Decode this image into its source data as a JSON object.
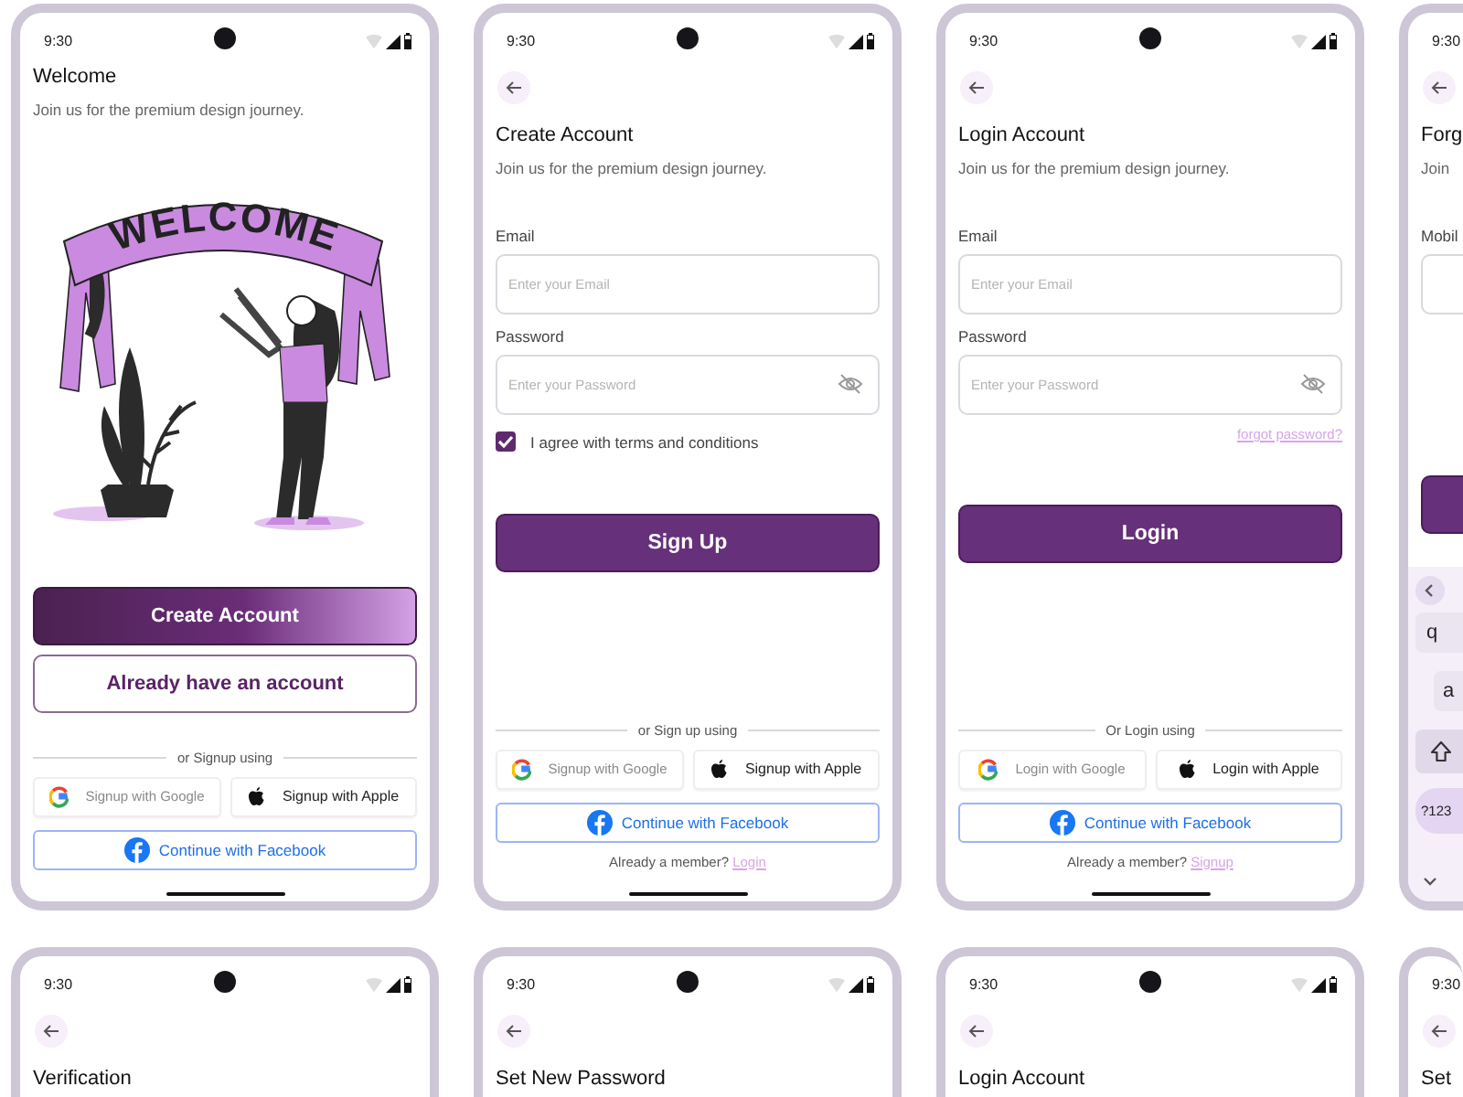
{
  "phones": [
    {
      "time": "9:30",
      "back_button": false,
      "home_indicator": true,
      "sections": [
        {
          "kind": "title",
          "text": "Welcome"
        },
        {
          "kind": "subtitle",
          "text": "Join us for the premium design journey."
        },
        {
          "kind": "illustration",
          "banner_text": "WELCOME"
        },
        {
          "kind": "gradient_button",
          "label": "Create Account"
        },
        {
          "kind": "outline_button",
          "label": "Already have an account"
        },
        {
          "kind": "divider",
          "text": "or Signup using"
        },
        {
          "kind": "social_row",
          "google": "Signup with Google",
          "apple": "Signup with Apple"
        },
        {
          "kind": "facebook",
          "label": "Continue with Facebook"
        }
      ]
    },
    {
      "time": "9:30",
      "back_button": true,
      "home_indicator": true,
      "sections": [
        {
          "kind": "title",
          "text": "Create Account"
        },
        {
          "kind": "subtitle",
          "text": "Join us for the premium design journey."
        },
        {
          "kind": "field",
          "secure": false,
          "label": "Email",
          "placeholder": "Enter your Email"
        },
        {
          "kind": "field",
          "secure": true,
          "label": "Password",
          "placeholder": "Enter your Password"
        },
        {
          "kind": "checkbox",
          "checked": true,
          "label": "I agree with terms and conditions"
        },
        {
          "kind": "solid_button",
          "label": "Sign Up"
        },
        {
          "kind": "divider",
          "text": "or Sign up using"
        },
        {
          "kind": "social_row",
          "google": "Signup with Google",
          "apple": "Signup with Apple"
        },
        {
          "kind": "facebook",
          "label": "Continue with Facebook"
        },
        {
          "kind": "footer",
          "text": "Already a member?",
          "link": "Login"
        }
      ]
    },
    {
      "time": "9:30",
      "back_button": true,
      "home_indicator": true,
      "sections": [
        {
          "kind": "title",
          "text": "Login Account"
        },
        {
          "kind": "subtitle",
          "text": "Join us for the premium design journey."
        },
        {
          "kind": "field",
          "secure": false,
          "label": "Email",
          "placeholder": "Enter your Email"
        },
        {
          "kind": "field",
          "secure": true,
          "label": "Password",
          "placeholder": "Enter your Password"
        },
        {
          "kind": "link",
          "text": "forgot password?"
        },
        {
          "kind": "solid_button",
          "label": "Login"
        },
        {
          "kind": "divider",
          "text": "Or Login using"
        },
        {
          "kind": "social_row",
          "google": "Login with Google",
          "apple": "Login with Apple"
        },
        {
          "kind": "facebook",
          "label": "Continue with Facebook"
        },
        {
          "kind": "footer",
          "text": "Already a member?",
          "link": "Signup"
        }
      ]
    },
    {
      "time": "9:30",
      "back_button": true,
      "home_indicator": false,
      "sections": [
        {
          "kind": "title",
          "text": "Forg"
        },
        {
          "kind": "subtitle",
          "text": "Join"
        },
        {
          "kind": "field",
          "secure": false,
          "label": "Mobil"
        },
        {
          "kind": "solid_button"
        },
        {
          "kind": "keyboard",
          "keys": [
            {
              "kind": "letter",
              "label": "q"
            },
            {
              "kind": "letter",
              "label": "a"
            },
            {
              "kind": "shift"
            },
            {
              "kind": "mode",
              "label": "?123"
            }
          ]
        }
      ]
    },
    {
      "time": "9:30",
      "back_button": true,
      "home_indicator": false,
      "sections": [
        {
          "kind": "title",
          "text": "Verification"
        }
      ]
    },
    {
      "time": "9:30",
      "back_button": true,
      "home_indicator": false,
      "sections": [
        {
          "kind": "title",
          "text": "Set New Password"
        }
      ]
    },
    {
      "time": "9:30",
      "back_button": true,
      "home_indicator": false,
      "sections": [
        {
          "kind": "title",
          "text": "Login Account"
        }
      ]
    },
    {
      "time": "9:30",
      "back_button": true,
      "home_indicator": false,
      "sections": [
        {
          "kind": "title",
          "text": "Set"
        }
      ]
    }
  ]
}
